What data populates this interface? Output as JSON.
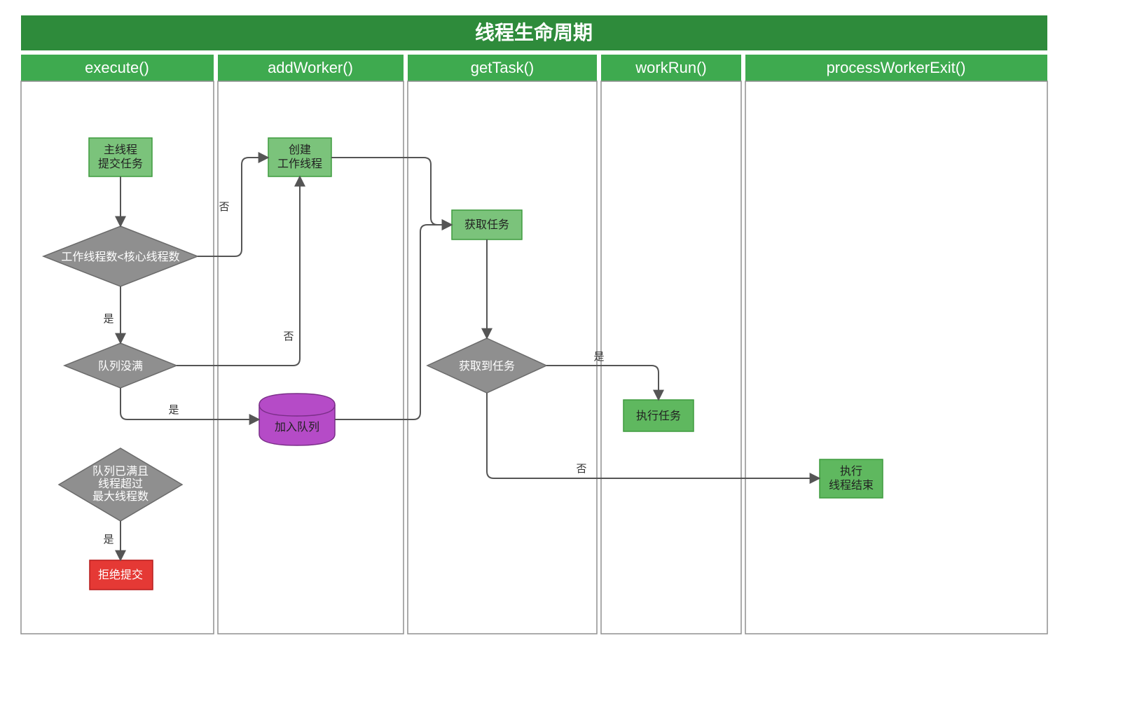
{
  "title": "线程生命周期",
  "lanes": [
    {
      "id": "execute",
      "label": "execute()"
    },
    {
      "id": "addWorker",
      "label": "addWorker()"
    },
    {
      "id": "getTask",
      "label": "getTask()"
    },
    {
      "id": "workRun",
      "label": "workRun()"
    },
    {
      "id": "processWorkerExit",
      "label": "processWorkerExit()"
    }
  ],
  "nodes": {
    "submit": {
      "lines": [
        "主线程",
        "提交任务"
      ]
    },
    "createWorker": {
      "lines": [
        "创建",
        "工作线程"
      ]
    },
    "getTask": {
      "lines": [
        "获取任务"
      ]
    },
    "checkCore": {
      "lines": [
        "工作线程数<核心线程数"
      ]
    },
    "queueNotFull": {
      "lines": [
        "队列没满"
      ]
    },
    "queueFullMax": {
      "lines": [
        "队列已满且",
        "线程超过",
        "最大线程数"
      ]
    },
    "gotTask": {
      "lines": [
        "获取到任务"
      ]
    },
    "enqueue": {
      "lines": [
        "加入队列"
      ]
    },
    "runTask": {
      "lines": [
        "执行任务"
      ]
    },
    "reject": {
      "lines": [
        "拒绝提交"
      ]
    },
    "threadEnd": {
      "lines": [
        "执行",
        "线程结束"
      ]
    }
  },
  "edgeLabels": {
    "yes": "是",
    "no": "否"
  }
}
